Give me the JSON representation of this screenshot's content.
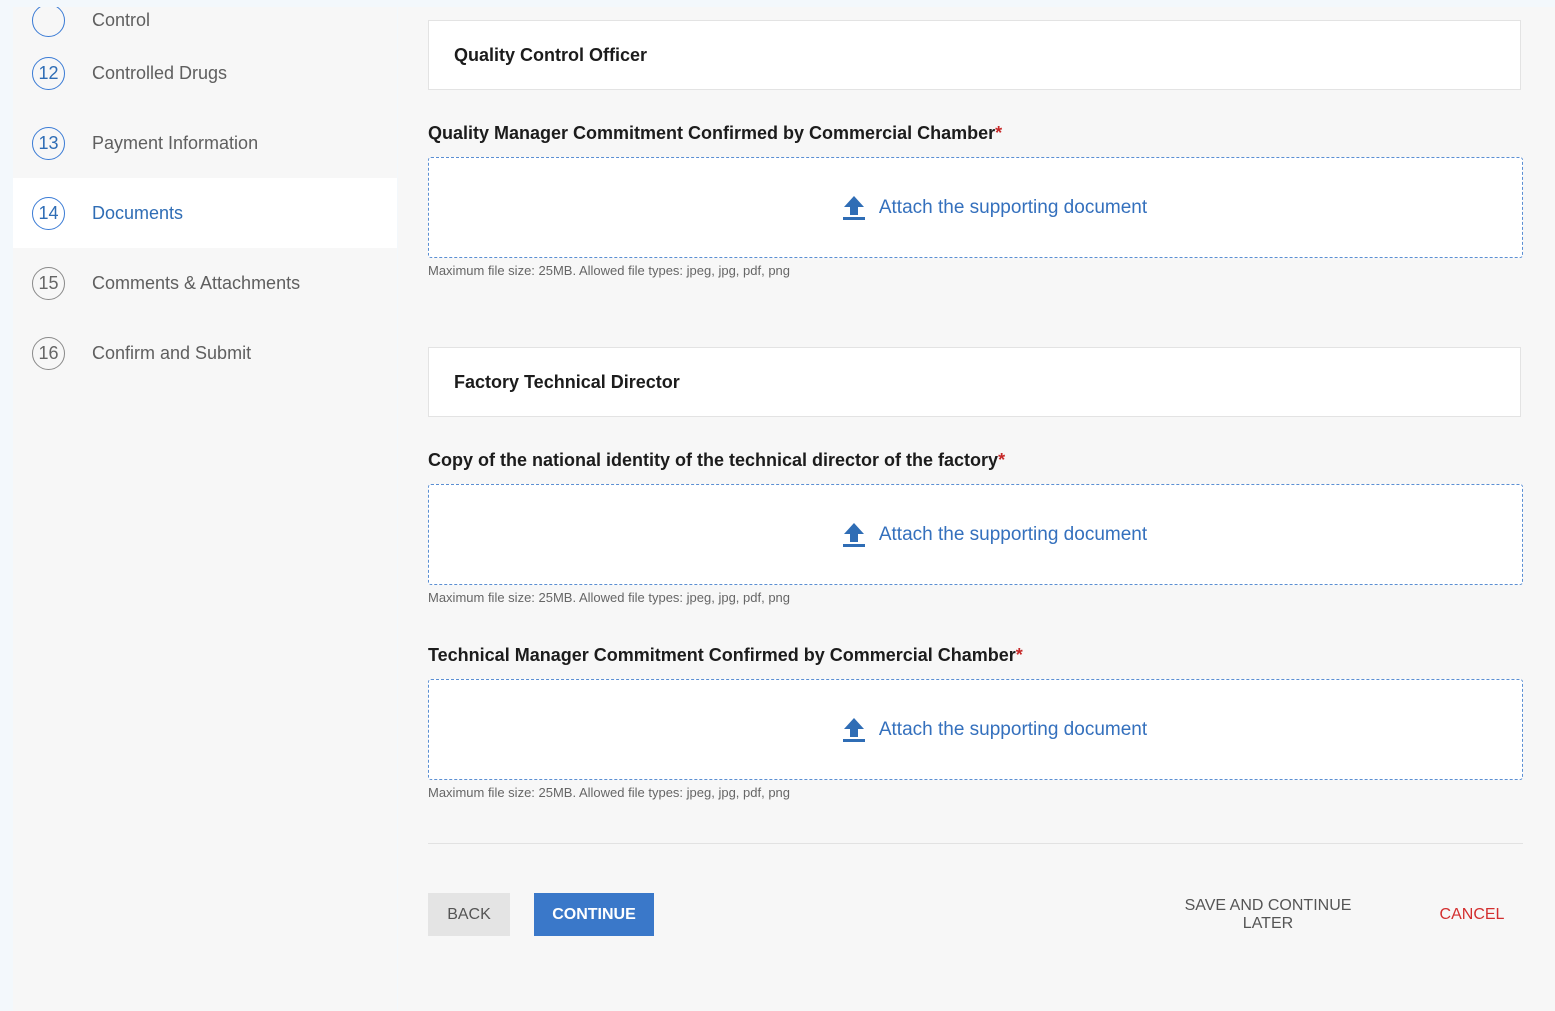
{
  "sidebar": {
    "items": [
      {
        "number": "",
        "label": "Control",
        "state": "partial"
      },
      {
        "number": "12",
        "label": "Controlled Drugs",
        "state": "done"
      },
      {
        "number": "13",
        "label": "Payment Information",
        "state": "done"
      },
      {
        "number": "14",
        "label": "Documents",
        "state": "active"
      },
      {
        "number": "15",
        "label": "Comments & Attachments",
        "state": "pending"
      },
      {
        "number": "16",
        "label": "Confirm and Submit",
        "state": "pending"
      }
    ]
  },
  "main": {
    "sections": [
      {
        "title": "Quality Control Officer",
        "fields": [
          {
            "label": "Quality Manager Commitment Confirmed by Commercial Chamber",
            "required_mark": "*",
            "upload_label": "Attach the supporting document",
            "hint": "Maximum file size: 25MB. Allowed file types: jpeg, jpg, pdf, png"
          }
        ]
      },
      {
        "title": "Factory Technical Director",
        "fields": [
          {
            "label": "Copy of the national identity of the technical director of the factory",
            "required_mark": "*",
            "upload_label": "Attach the supporting document",
            "hint": "Maximum file size: 25MB. Allowed file types: jpeg, jpg, pdf, png"
          },
          {
            "label": "Technical Manager Commitment Confirmed by Commercial Chamber",
            "required_mark": "*",
            "upload_label": "Attach the supporting document",
            "hint": "Maximum file size: 25MB. Allowed file types: jpeg, jpg, pdf, png"
          }
        ]
      }
    ]
  },
  "actions": {
    "back": "BACK",
    "continue": "CONTINUE",
    "save_later": "SAVE AND CONTINUE LATER",
    "cancel": "CANCEL"
  },
  "colors": {
    "accent": "#3a78c9",
    "link": "#3470bd",
    "danger": "#d32f2f",
    "required": "#c62828"
  },
  "icons": {
    "upload": "upload-arrow-icon"
  }
}
